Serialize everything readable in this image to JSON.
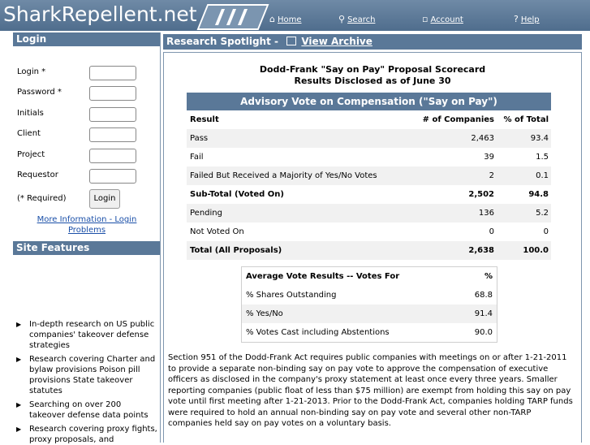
{
  "header": {
    "logo": "SharkRepellent.net",
    "nav": [
      {
        "label": "Home",
        "icon": "home-icon",
        "glyph": "⌂"
      },
      {
        "label": "Search",
        "icon": "search-icon",
        "glyph": "⚲"
      },
      {
        "label": "Account",
        "icon": "lock-icon",
        "glyph": "🔒︎"
      },
      {
        "label": "Help",
        "icon": "help-icon",
        "glyph": "?"
      }
    ]
  },
  "login": {
    "title": "Login",
    "fields": [
      {
        "label": "Login *",
        "value": ""
      },
      {
        "label": "Password *",
        "value": ""
      },
      {
        "label": "Initials",
        "value": ""
      },
      {
        "label": "Client",
        "value": ""
      },
      {
        "label": "Project",
        "value": ""
      },
      {
        "label": "Requestor",
        "value": ""
      }
    ],
    "required_note": "(* Required)",
    "button": "Login",
    "more_info_link": "More Information - Login Problems"
  },
  "site_features": {
    "title": "Site Features",
    "items": [
      "In-depth research on US public companies' takeover defense strategies",
      "Research covering Charter and bylaw provisions Poison pill provisions State takeover statutes",
      "Searching on over 200 takeover defense data points",
      "Research covering proxy fights, proxy proposals, and"
    ]
  },
  "spotlight": {
    "title": "Research Spotlight  -",
    "archive_link": "View Archive",
    "archive_icon": "archive-icon",
    "heading_line1": "Dodd-Frank \"Say on Pay\" Proposal Scorecard",
    "heading_line2": "Results Disclosed as of June 30"
  },
  "advisory_table": {
    "title": "Advisory Vote on Compensation (\"Say on Pay\")",
    "headers": [
      "Result",
      "# of Companies",
      "% of Total"
    ],
    "rows": [
      {
        "result": "Pass",
        "count": "2,463",
        "pct": "93.4",
        "bold": false
      },
      {
        "result": "Fail",
        "count": "39",
        "pct": "1.5",
        "bold": false
      },
      {
        "result": "Failed But Received a Majority of Yes/No Votes",
        "count": "2",
        "pct": "0.1",
        "bold": false
      },
      {
        "result": "Sub-Total (Voted On)",
        "count": "2,502",
        "pct": "94.8",
        "bold": true
      },
      {
        "result": "Pending",
        "count": "136",
        "pct": "5.2",
        "bold": false
      },
      {
        "result": "Not Voted On",
        "count": "0",
        "pct": "0",
        "bold": false
      },
      {
        "result": "Total (All Proposals)",
        "count": "2,638",
        "pct": "100.0",
        "bold": true
      }
    ]
  },
  "average_table": {
    "headers": [
      "Average Vote Results -- Votes For",
      "%"
    ],
    "rows": [
      {
        "label": "% Shares Outstanding",
        "value": "68.8"
      },
      {
        "label": "% Yes/No",
        "value": "91.4"
      },
      {
        "label": "% Votes Cast including Abstentions",
        "value": "90.0"
      }
    ]
  },
  "paragraph": "Section 951 of the Dodd-Frank Act requires public companies with meetings on or after 1-21-2011 to provide a separate non-binding say on pay vote to approve the compensation of executive officers as disclosed in the company's proxy statement at least once every three years. Smaller reporting companies (public float of less than $75 million) are exempt from holding this say on pay vote until first meeting after 1-21-2013. Prior to the Dodd-Frank Act, companies holding TARP funds were required to hold an annual non-binding say on pay vote and several other non-TARP companies held say on pay votes on a voluntary basis.",
  "colors": {
    "header": "#5a7898",
    "link": "#1a4fa8"
  }
}
